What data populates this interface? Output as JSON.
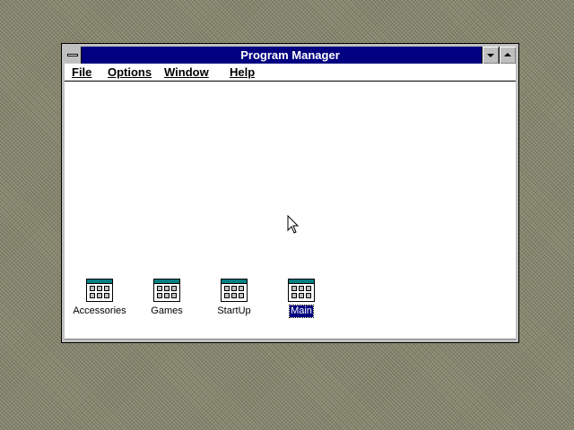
{
  "window": {
    "title": "Program Manager"
  },
  "menu": [
    {
      "label": "File"
    },
    {
      "label": "Options"
    },
    {
      "label": "Window"
    },
    {
      "label": "Help"
    }
  ],
  "groups": [
    {
      "label": "Accessories",
      "icon": "program-group-icon",
      "selected": false
    },
    {
      "label": "Games",
      "icon": "program-group-icon",
      "selected": false
    },
    {
      "label": "StartUp",
      "icon": "program-group-icon",
      "selected": false
    },
    {
      "label": "Main",
      "icon": "program-group-icon",
      "selected": true
    }
  ],
  "icons": {
    "system_menu": "system-menu-icon",
    "minimize": "minimize-icon",
    "maximize": "maximize-icon",
    "cursor": "mouse-pointer-icon"
  },
  "colors": {
    "titlebar": "#000080",
    "window_face": "#c0c0c0",
    "client": "#ffffff",
    "selection": "#000080"
  }
}
